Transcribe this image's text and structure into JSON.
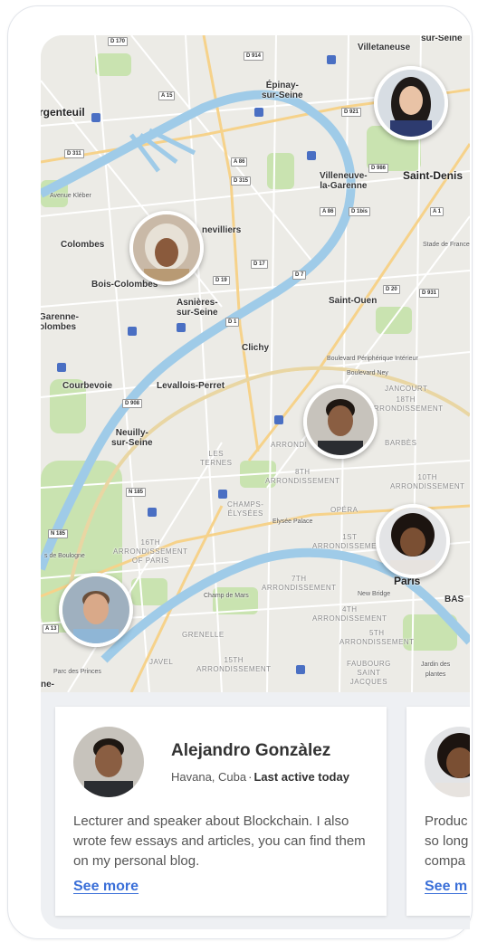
{
  "map": {
    "places": {
      "villetaneuse": "Villetaneuse",
      "sur_seine_top": "sur-Seine",
      "argenteuil": "rgenteuil",
      "epinay": "Épinay-\nsur-Seine",
      "villeneuve": "Villeneuve-\nla-Garenne",
      "saint_denis": "Saint-Denis",
      "nevilliers": "nevilliers",
      "colombes": "Colombes",
      "stade": "Stade de France",
      "bois_colombes": "Bois-Colombes",
      "asnieres": "Asnières-\nsur-Seine",
      "saint_ouen": "Saint-Ouen",
      "garenne": "Garenne-\nolombes",
      "clichy": "Clichy",
      "courbevoie": "Courbevoie",
      "levallois": "Levallois-Perret",
      "neuilly": "Neuilly-\nsur-Seine",
      "paris": "Paris",
      "bois_boulogne": "s de Boulogne",
      "champ_mars": "Champ de Mars",
      "parc_princes": "Parc des Princes",
      "ne": "ne-",
      "jardin": "Jardin des\nplantes",
      "new_bridge": "New Bridge",
      "elysee": "Elysée Palace",
      "boulevard_peri": "Boulevard Périphérique Intérieur",
      "boulevard_ney": "Boulevard Ney",
      "avenue_kleber": "Avenue Kléber",
      "bas": "BAS"
    },
    "districts": {
      "d18": "18TH\nARRONDISSEMENT",
      "d17": "ARRONDI",
      "les_ternes": "LES\nTERNES",
      "d8": "8TH\nARRONDISSEMENT",
      "champs": "CHAMPS-\nÉLYSÉES",
      "opera": "OPÉRA",
      "d10": "10TH\nARRONDISSEMENT",
      "d16": "16TH\nARRONDISSEMENT\nOF PARIS",
      "d1": "1ST\nARRONDISSEMENT",
      "d7": "7TH\nARRONDISSEMENT",
      "d4": "4TH\nARRONDISSEMENT",
      "d5": "5TH\nARRONDISSEMENT",
      "grenelle": "GRENELLE",
      "javel": "JAVEL",
      "d15": "15TH\nARRONDISSEMENT",
      "faubourg": "FAUBOURG\nSAINT\nJACQUES",
      "barbes": "BARBÈS",
      "jancourt": "JANCOURT"
    },
    "roads": [
      "D 170",
      "D 914",
      "A 15",
      "D 921",
      "D 311",
      "A 86",
      "D 315",
      "A 86",
      "D 986",
      "A 1",
      "D 19",
      "D 17",
      "D 7",
      "D 20",
      "D 931",
      "D 1",
      "D 908",
      "N 185",
      "N 185",
      "A 13",
      "D 1bis"
    ]
  },
  "profiles": [
    {
      "name": "Alejandro Gonzàlez",
      "location": "Havana, Cuba",
      "separator": "·",
      "last_active": "Last active today",
      "bio": "Lecturer and speaker about Blockchain. I also wrote few essays and articles, you can find them on my personal blog.",
      "link": "See more"
    },
    {
      "bio": "Produc\nso long\ncompa",
      "link": "See m"
    }
  ],
  "colors": {
    "accent": "#3a6fd8",
    "water": "#9fcbe8",
    "park": "#c9e3b0",
    "map_bg": "#ecebe6"
  }
}
